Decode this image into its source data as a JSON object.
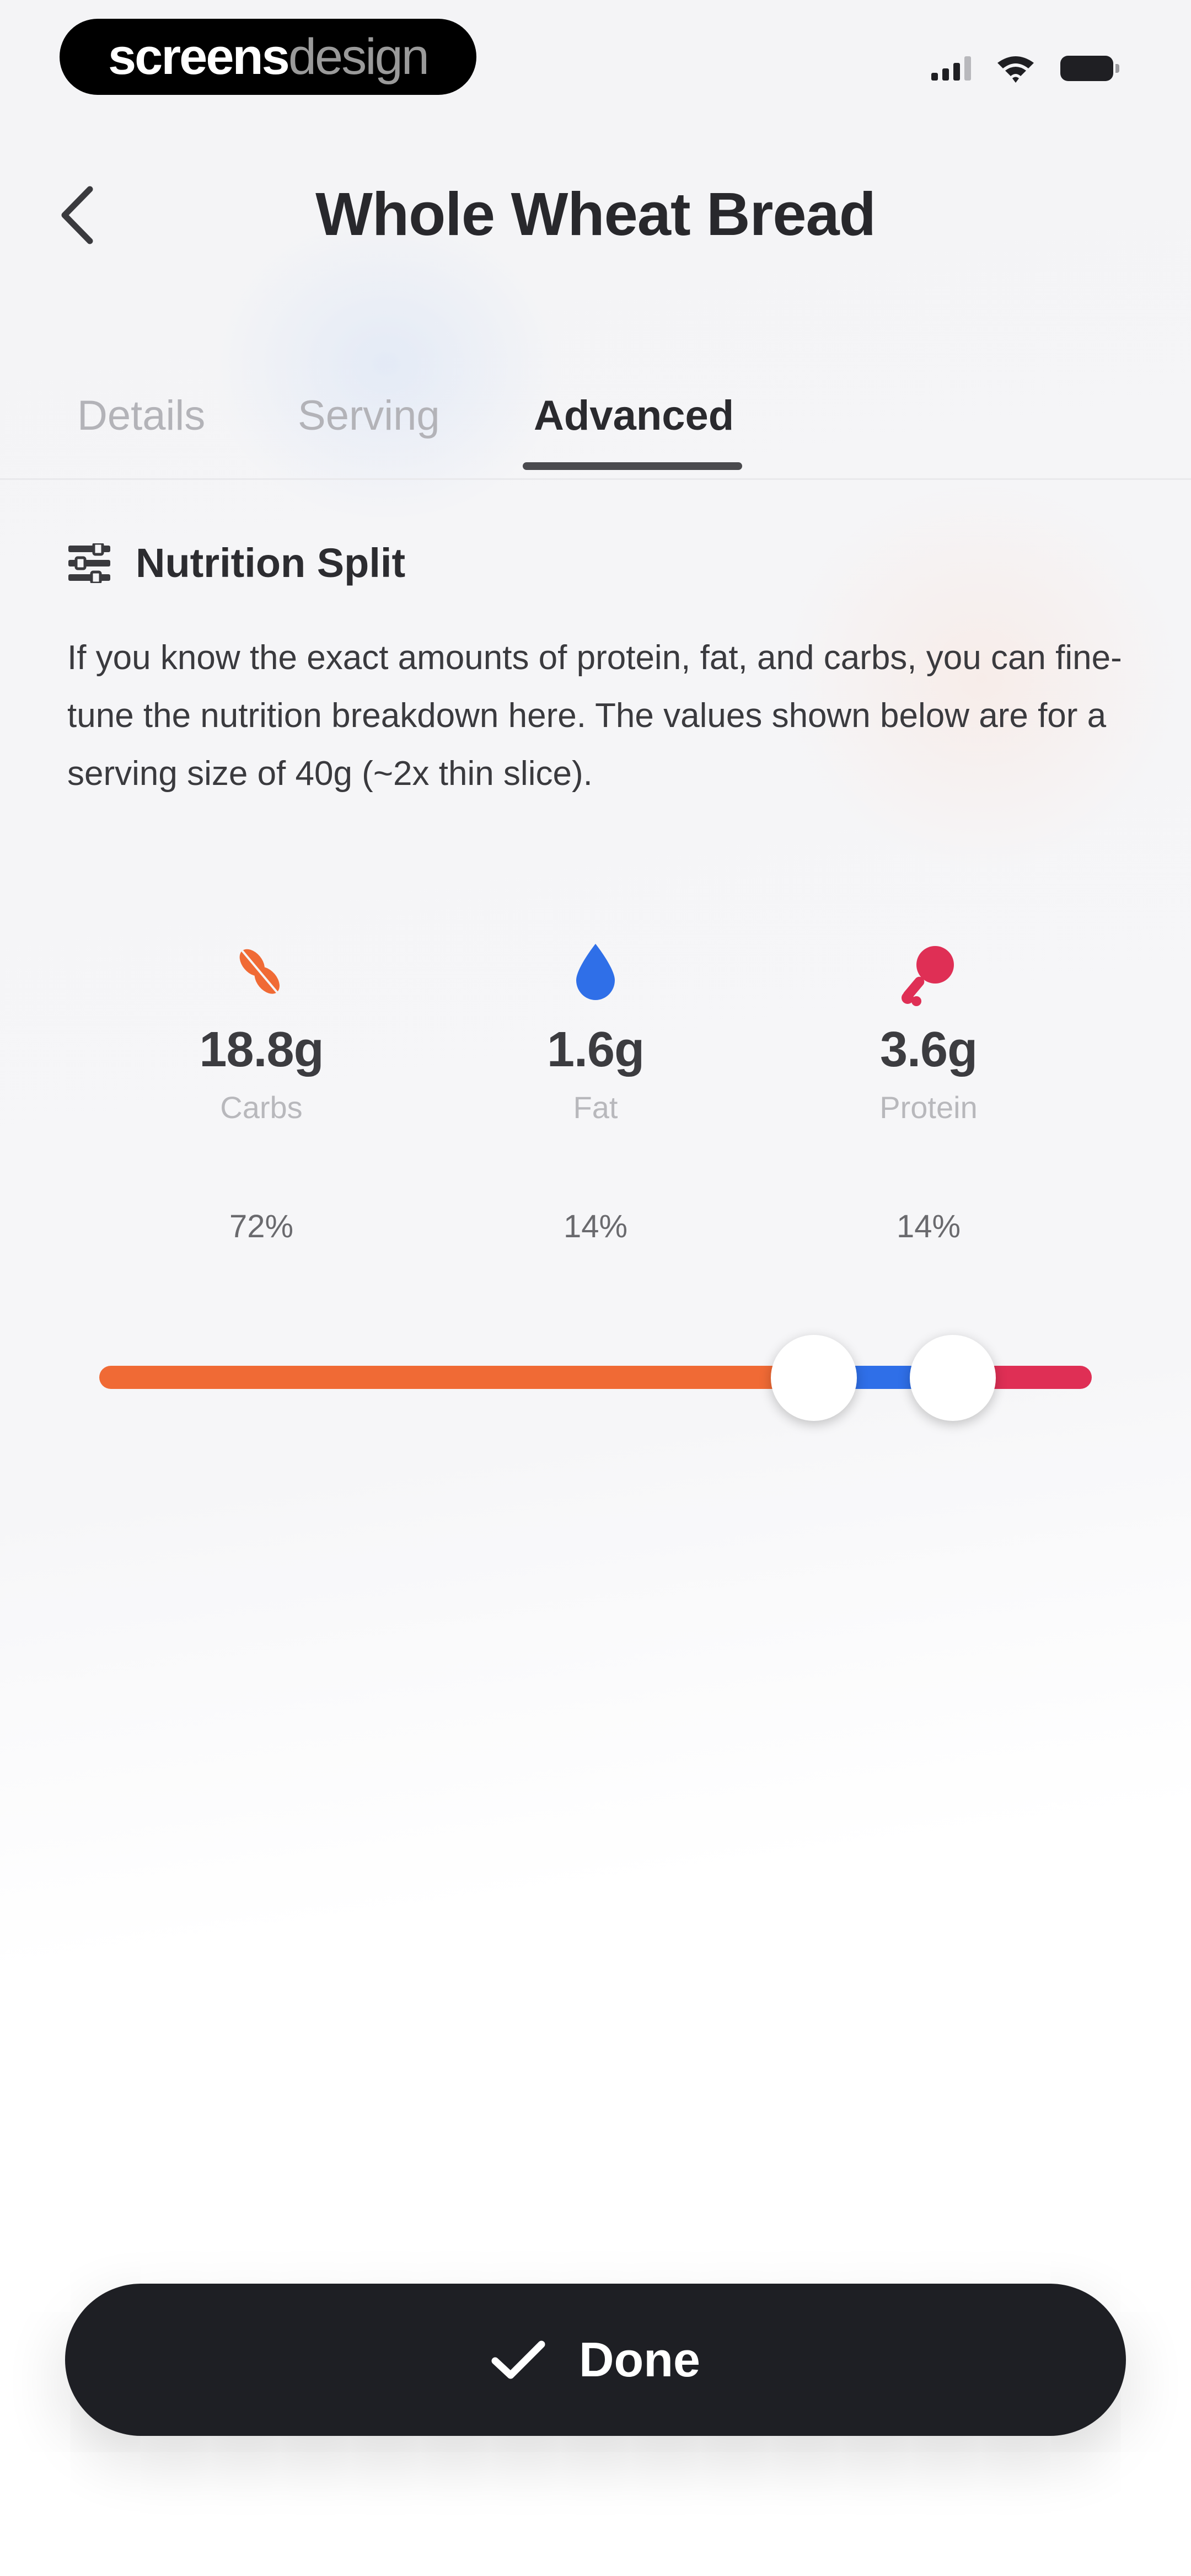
{
  "status_bar": {
    "brand_part1": "screens",
    "brand_part2": "design",
    "icons": [
      "signal-icon",
      "wifi-icon",
      "battery-icon"
    ]
  },
  "nav": {
    "back_icon": "chevron-left-icon",
    "title": "Whole Wheat Bread"
  },
  "tabs": [
    {
      "label": "Details",
      "active": false
    },
    {
      "label": "Serving",
      "active": false
    },
    {
      "label": "Advanced",
      "active": true
    }
  ],
  "section": {
    "icon": "sliders-icon",
    "title": "Nutrition Split",
    "description": "If you know the exact amounts of protein, fat, and carbs, you can fine-tune the nutrition breakdown here. The values shown below are for a serving size of 40g (~2x thin slice)."
  },
  "macros": [
    {
      "name": "Carbs",
      "value": "18.8g",
      "percent": "72%",
      "percent_value": 72,
      "color": "#F06A35",
      "icon": "wheat-icon"
    },
    {
      "name": "Fat",
      "value": "1.6g",
      "percent": "14%",
      "percent_value": 14,
      "color": "#2F6FE8",
      "icon": "drop-icon"
    },
    {
      "name": "Protein",
      "value": "3.6g",
      "percent": "14%",
      "percent_value": 14,
      "color": "#DF2F55",
      "icon": "drumstick-icon"
    }
  ],
  "done_button": {
    "icon": "checkmark-icon",
    "label": "Done"
  },
  "colors": {
    "background": "#F5F5F7",
    "button_dark": "#1E1F24",
    "tab_active": "#2A2A2E",
    "tab_inactive": "#B3B3B8"
  }
}
